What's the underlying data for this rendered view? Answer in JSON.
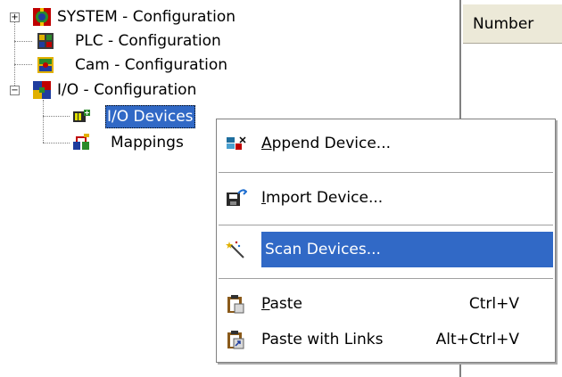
{
  "tree": {
    "items": [
      {
        "label": "SYSTEM - Configuration",
        "expander": "+"
      },
      {
        "label": "PLC - Configuration"
      },
      {
        "label": "Cam - Configuration"
      },
      {
        "label": "I/O - Configuration",
        "expander": "−"
      },
      {
        "label": "I/O Devices",
        "selected": true
      },
      {
        "label": "Mappings"
      }
    ]
  },
  "list": {
    "columns": [
      "Number"
    ]
  },
  "context_menu": {
    "append_prefix": "",
    "append_accel": "A",
    "append_rest": "ppend Device...",
    "import_accel": "I",
    "import_rest": "mport Device...",
    "scan_label": "Scan Devices...",
    "paste_accel": "P",
    "paste_rest": "aste",
    "paste_shortcut": "Ctrl+V",
    "paste_links_label": "Paste with Links",
    "paste_links_shortcut": "Alt+Ctrl+V"
  },
  "colors": {
    "selection": "#3169c6",
    "header_bg": "#ece9d8"
  }
}
